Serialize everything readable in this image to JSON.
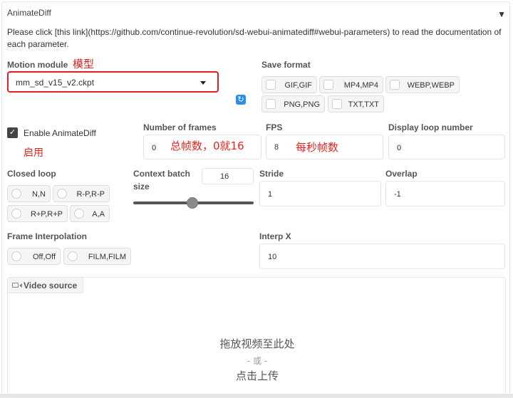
{
  "panel": {
    "title": "AnimateDiff",
    "collapse_glyph": "▼",
    "description": "Please click [this link](https://github.com/continue-revolution/sd-webui-animatediff#webui-parameters) to read the documentation of each parameter."
  },
  "motion_module": {
    "label": "Motion module",
    "value": "mm_sd_v15_v2.ckpt",
    "annotation": "模型",
    "refresh_icon": "refresh-icon"
  },
  "save_format": {
    "label": "Save format",
    "options": [
      "GIF,GIF",
      "MP4,MP4",
      "WEBP,WEBP",
      "PNG,PNG",
      "TXT,TXT"
    ]
  },
  "enable": {
    "label": "Enable AnimateDiff",
    "checked": true,
    "annotation": "启用"
  },
  "number_of_frames": {
    "label": "Number of frames",
    "value": "0",
    "annotation": "总帧数，0就16"
  },
  "fps": {
    "label": "FPS",
    "value": "8",
    "annotation": "每秒帧数"
  },
  "display_loop": {
    "label": "Display loop number",
    "value": "0"
  },
  "closed_loop": {
    "label": "Closed loop",
    "options": [
      "N,N",
      "R-P,R-P",
      "R+P,R+P",
      "A,A"
    ]
  },
  "context_batch": {
    "label_line1": "Context batch",
    "label_line2": "size",
    "value": "16",
    "slider_fraction": 0.5
  },
  "stride": {
    "label": "Stride",
    "value": "1"
  },
  "overlap": {
    "label": "Overlap",
    "value": "-1"
  },
  "frame_interpolation": {
    "label": "Frame Interpolation",
    "options": [
      "Off,Off",
      "FILM,FILM"
    ]
  },
  "interp_x": {
    "label": "Interp X",
    "value": "10"
  },
  "video_source": {
    "tab_label": "Video source",
    "drop_line1": "拖放视频至此处",
    "drop_line2": "- 或 -",
    "drop_line3": "点击上传"
  },
  "colors": {
    "annotation_red": "#e8231f",
    "accent_blue": "#2c8ee8"
  }
}
